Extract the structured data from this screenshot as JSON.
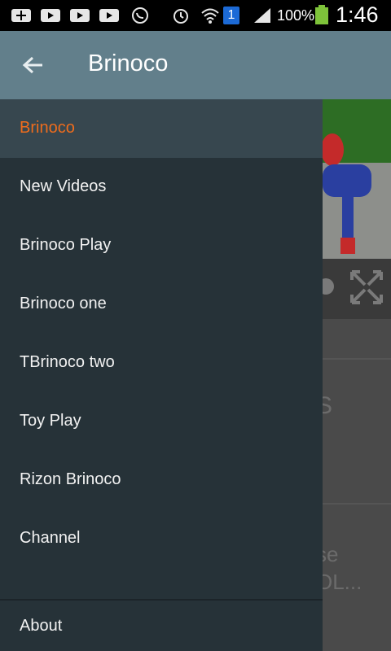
{
  "status_bar": {
    "icons": [
      "add-icon",
      "video-icon",
      "video-icon",
      "video-icon",
      "whatsapp-icon",
      "alarm-icon",
      "wifi-icon",
      "sim-icon",
      "signal-icon",
      "battery-icon"
    ],
    "sim_slot": "1",
    "battery_text": "100%",
    "time": "1:46"
  },
  "app_bar": {
    "title": "Brinoco",
    "back_icon": "arrow-back-icon",
    "color": "#627f8b"
  },
  "drawer": {
    "items": [
      {
        "label": "Brinoco",
        "active": true
      },
      {
        "label": "New Videos"
      },
      {
        "label": "Brinoco Play"
      },
      {
        "label": "Brinoco one"
      },
      {
        "label": "TBrinoco two"
      },
      {
        "label": "Toy Play"
      },
      {
        "label": "Rizon Brinoco"
      },
      {
        "label": "Channel"
      }
    ],
    "footer_item": {
      "label": "About"
    },
    "active_color": "#ef6c1c",
    "background": "#263238"
  },
  "background_content": {
    "text_1": "S",
    "text_2": ".",
    "text_3": "se",
    "text_4": "OL..."
  }
}
